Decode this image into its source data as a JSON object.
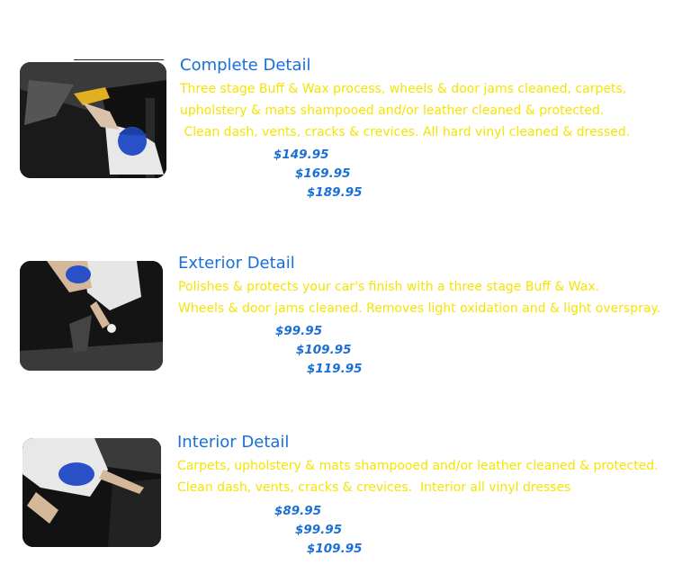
{
  "services": [
    {
      "title": "Complete Detail",
      "description": [
        "Three stage Buff & Wax process, wheels & door jams cleaned, carpets,",
        "upholstery & mats shampooed and/or leather cleaned & protected.",
        " Clean dash, vents, cracks & crevices. All hard vinyl cleaned & dressed."
      ],
      "prices": [
        "$149.95",
        "$169.95",
        "$189.95"
      ],
      "image": "detailer-cleaning-interior-photo"
    },
    {
      "title": "Exterior Detail",
      "description": [
        "Polishes & protects your car's finish with a three stage Buff & Wax.",
        "Wheels & door jams cleaned. Removes light oxidation and & light overspray."
      ],
      "prices": [
        "$99.95",
        "$109.95",
        "$119.95"
      ],
      "image": "detailer-polishing-exterior-photo"
    },
    {
      "title": "Interior Detail",
      "description": [
        "Carpets, upholstery & mats shampooed and/or leather cleaned & protected.",
        "Clean dash, vents, cracks & crevices.  Interior all vinyl dresses"
      ],
      "prices": [
        "$89.95",
        "$99.95",
        "$109.95"
      ],
      "image": "detailer-cleaning-seats-photo"
    }
  ],
  "colors": {
    "title": "#1a6fd6",
    "description": "#f5e400",
    "price": "#1a6fd6",
    "background": "#ffffff"
  }
}
